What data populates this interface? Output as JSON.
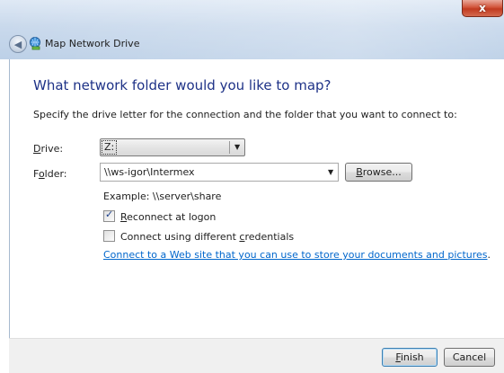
{
  "window": {
    "title": "Map Network Drive",
    "close_glyph": "x"
  },
  "main": {
    "heading": "What network folder would you like to map?",
    "description": "Specify the drive letter for the connection and the folder that you want to connect to:"
  },
  "drive": {
    "label_prefix": "",
    "label_mnemonic": "D",
    "label_rest": "rive:",
    "value": "Z:"
  },
  "folder": {
    "label_pre": "F",
    "label_mnemonic": "o",
    "label_rest": "lder:",
    "value": "\\\\ws-igor\\Intermex",
    "browse_mnemonic": "B",
    "browse_rest": "rowse..."
  },
  "example": "Example: \\\\server\\share",
  "reconnect": {
    "checked": true,
    "mnemonic": "R",
    "rest": "econnect at logon"
  },
  "credentials": {
    "checked": false,
    "pre": "Connect using different ",
    "mnemonic": "c",
    "rest": "redentials"
  },
  "link": {
    "text": "Connect to a Web site that you can use to store your documents and pictures",
    "suffix": "."
  },
  "footer": {
    "finish_mnemonic": "F",
    "finish_rest": "inish",
    "cancel": "Cancel"
  }
}
